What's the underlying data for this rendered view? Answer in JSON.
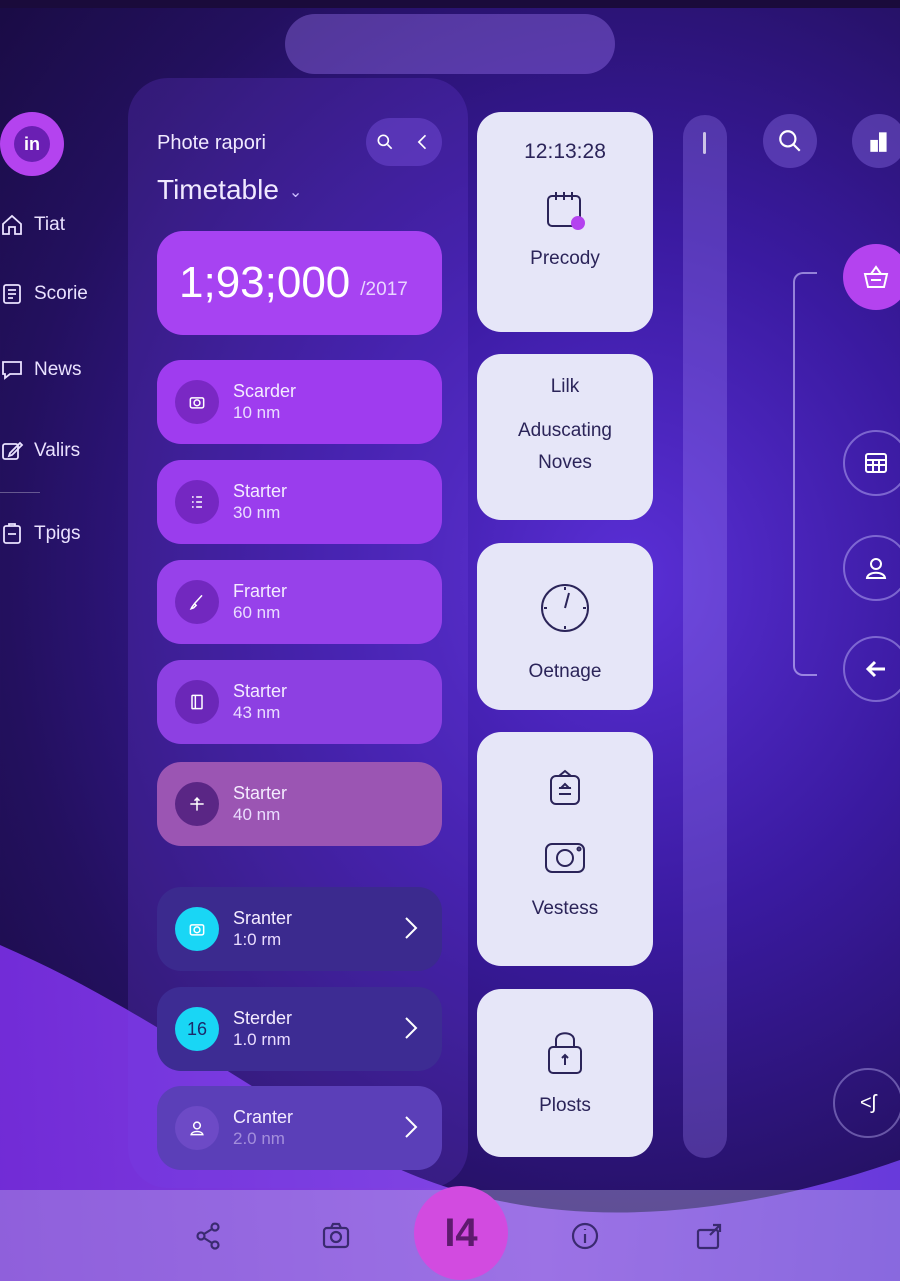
{
  "sidebar": {
    "brand_label": "in",
    "items": [
      {
        "label": "Tiat",
        "icon": "home-icon"
      },
      {
        "label": "Scorie",
        "icon": "document-icon"
      },
      {
        "label": "News",
        "icon": "chat-icon"
      },
      {
        "label": "Valirs",
        "icon": "edit-icon"
      },
      {
        "label": "Tpigs",
        "icon": "clipboard-icon"
      }
    ]
  },
  "panel": {
    "subtitle": "Phote rapori",
    "title": "Timetable",
    "highlight": {
      "value": "1;93;000",
      "year": "/2017"
    },
    "rows": [
      {
        "title": "Scarder",
        "sub": "10 nm",
        "icon": "camera-icon"
      },
      {
        "title": "Starter",
        "sub": "30 nm",
        "icon": "list-icon"
      },
      {
        "title": "Frarter",
        "sub": "60 nm",
        "icon": "brush-icon"
      },
      {
        "title": "Starter",
        "sub": "43 nm",
        "icon": "book-icon"
      },
      {
        "title": "Starter",
        "sub": "40 nm",
        "icon": "move-icon"
      },
      {
        "title": "Sranter",
        "sub": "1:0 rm",
        "icon": "camera-icon"
      },
      {
        "title": "Sterder",
        "sub": "1.0 rnm",
        "badge": "16"
      },
      {
        "title": "Cranter",
        "sub": "2.0 nm",
        "icon": "user-icon"
      }
    ]
  },
  "tiles": [
    {
      "time": "12:13:28",
      "label": "Precody",
      "icon": "calendar-icon"
    },
    {
      "line1": "Lilk",
      "line2": "Aduscating",
      "line3": "Noves"
    },
    {
      "label": "Oetnage",
      "icon": "clock-icon"
    },
    {
      "label": "Vestess",
      "icon": "camera-icon"
    },
    {
      "label": "Plosts",
      "icon": "lock-icon"
    }
  ],
  "right_rail": {
    "top_icons": [
      "search-icon",
      "bar-chart-icon"
    ],
    "group_icons": [
      "basket-icon",
      "calendar-grid-icon",
      "user-icon",
      "arrow-left-icon"
    ],
    "bottom_icon_label": "<ʃ"
  },
  "bottom_bar": {
    "fab_label": "I4",
    "icons": [
      "share-icon",
      "camera-icon",
      "info-icon",
      "export-icon"
    ]
  },
  "colors": {
    "accent": "#a743f2",
    "fab": "#d24be0",
    "tile_bg": "#e6e6f8",
    "badge_cyan": "#19d6f5"
  }
}
